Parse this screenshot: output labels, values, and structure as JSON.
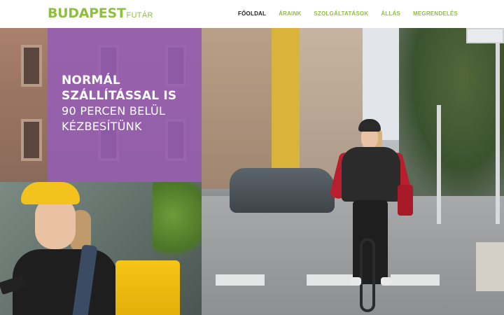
{
  "brand": {
    "name": "BUDAPEST",
    "sub": "FUTÁR",
    "color": "#8dc03f"
  },
  "nav": {
    "items": [
      {
        "label": "FŐOLDAL",
        "active": true
      },
      {
        "label": "ÁRAINK",
        "active": false
      },
      {
        "label": "SZOLGÁLTATÁSOK",
        "active": false
      },
      {
        "label": "ÁLLÁS",
        "active": false
      },
      {
        "label": "MEGRENDELÉS",
        "active": false
      }
    ]
  },
  "hero": {
    "line1": "NORMÁL",
    "line2": "SZÁLLÍTÁSSAL IS",
    "line3": "90 PERCEN BELÜL",
    "line4": "KÉZBESÍTÜNK",
    "overlay_color": "#955db4"
  },
  "images": {
    "left_photo": "courier-woman-photo",
    "right_photo": "cyclist-city-street-photo"
  }
}
